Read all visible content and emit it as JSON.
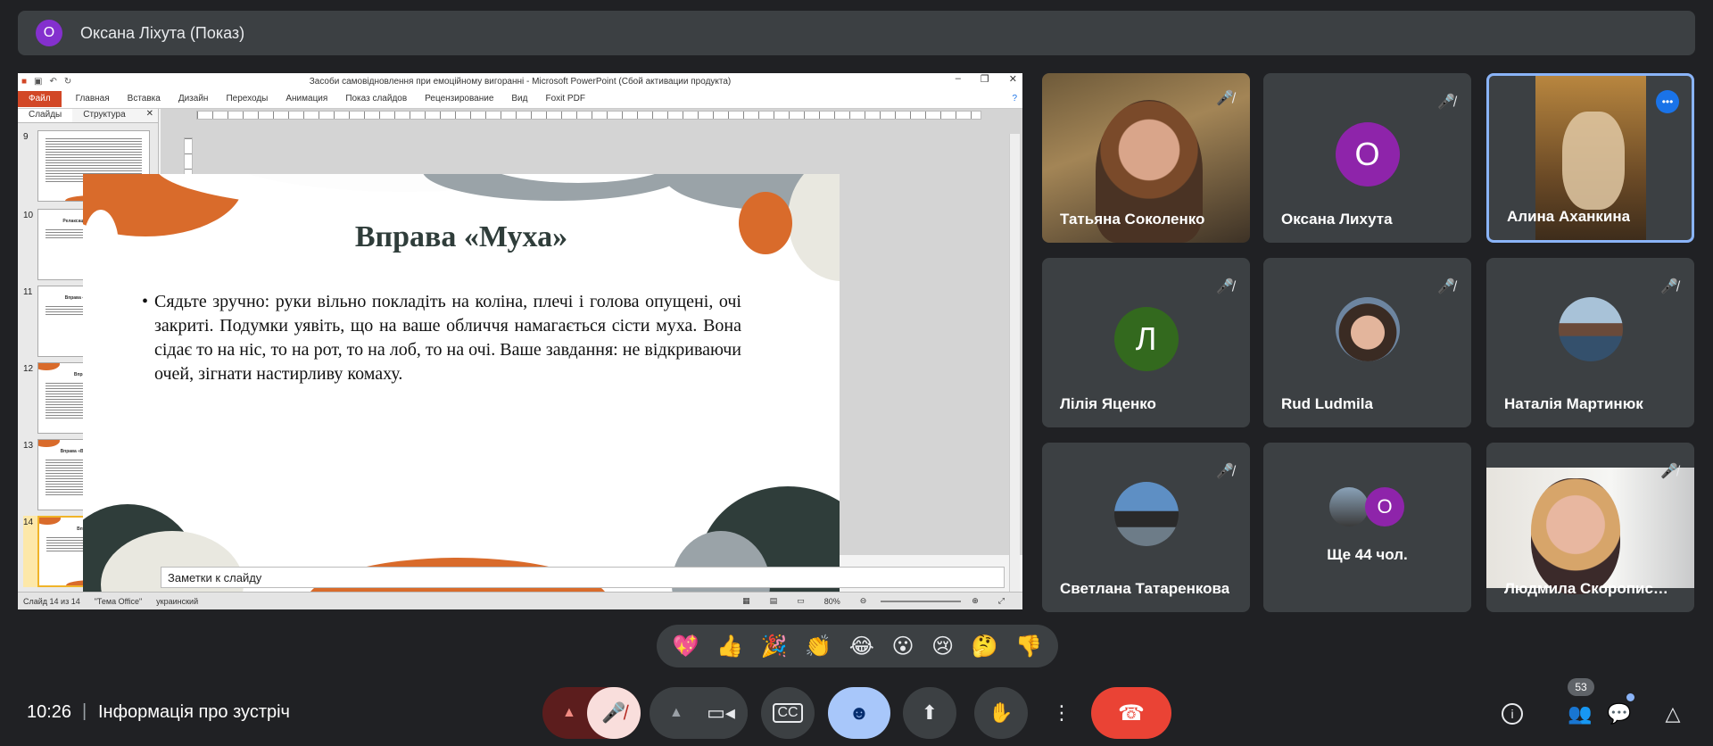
{
  "presenter": {
    "avatar_letter": "О",
    "label": "Оксана Ліхута (Показ)"
  },
  "ppt": {
    "window_title": "Засоби самовідновлення при емоційному вигоранні  -  Microsoft PowerPoint (Сбой активации продукта)",
    "ribbon_file": "Файл",
    "ribbon_tabs": [
      "Главная",
      "Вставка",
      "Дизайн",
      "Переходы",
      "Анимация",
      "Показ слайдов",
      "Рецензирование",
      "Вид",
      "Foxit PDF"
    ],
    "panel_tabs": [
      "Слайды",
      "Структура"
    ],
    "thumbnails": [
      {
        "num": "9",
        "title": ""
      },
      {
        "num": "10",
        "title": "Релаксація «Трійкове поле»"
      },
      {
        "num": "11",
        "title": "Вправа «Прохолод стрес»"
      },
      {
        "num": "12",
        "title": "Вправа «Світчик»"
      },
      {
        "num": "13",
        "title": "Вправа «Внутрішній промінь»"
      },
      {
        "num": "14",
        "title": "Вправа «Муха»"
      }
    ],
    "slide_title": "Вправа «Муха»",
    "slide_body": "Сядьте зручно: руки вільно покладіть на коліна, плечі і голова опущені, очі закриті. Подумки уявіть, що на ваше обличчя намагається сісти муха. Вона сідає то на ніс, то на рот, то на лоб, то на очі. Ваше завдання: не відкриваючи очей, зігнати настирливу комаху.",
    "notes_placeholder": "Заметки к слайду",
    "status_slide": "Слайд 14 из 14",
    "status_theme": "\"Тема Office\"",
    "status_lang": "украинский",
    "zoom": "80%"
  },
  "participants": [
    {
      "name": "Татьяна Соколенко",
      "type": "video",
      "muted": true
    },
    {
      "name": "Оксана Лихута",
      "type": "letter",
      "letter": "О",
      "color": "#8e24aa",
      "muted": true
    },
    {
      "name": "Алина Аханкина",
      "type": "video",
      "speaking": true
    },
    {
      "name": "Лілія Яценко",
      "type": "letter",
      "letter": "Л",
      "color": "#33691e",
      "muted": true
    },
    {
      "name": "Rud Ludmila",
      "type": "photo",
      "muted": true
    },
    {
      "name": "Наталія Мартинюк",
      "type": "photo",
      "muted": true
    },
    {
      "name": "Светлана Татаренкова",
      "type": "photo",
      "muted": true
    },
    {
      "name": "Ще 44 чол.",
      "type": "more",
      "letter": "О"
    },
    {
      "name": "Людмила Скорописцева",
      "type": "video",
      "muted": true
    }
  ],
  "reactions": [
    "💖",
    "👍",
    "🎉",
    "👏",
    "😂",
    "😮",
    "😢",
    "🤔",
    "👎"
  ],
  "bottom": {
    "time": "10:26",
    "separator": "|",
    "meeting_info": "Інформація про зустріч",
    "people_count": "53"
  },
  "icons": {
    "mic_off": "mic-off-icon",
    "camera": "camera-icon",
    "captions": "captions-icon",
    "emoji": "emoji-icon",
    "present": "present-icon",
    "hand": "hand-icon",
    "more": "more-icon",
    "end_call": "end-call-icon",
    "info": "info-icon",
    "people": "people-icon",
    "chat": "chat-icon",
    "activities": "activities-icon"
  },
  "colors": {
    "accent": "#8ab4f8",
    "end_call": "#ea4335",
    "mic_off_bg": "#f9dedc"
  }
}
